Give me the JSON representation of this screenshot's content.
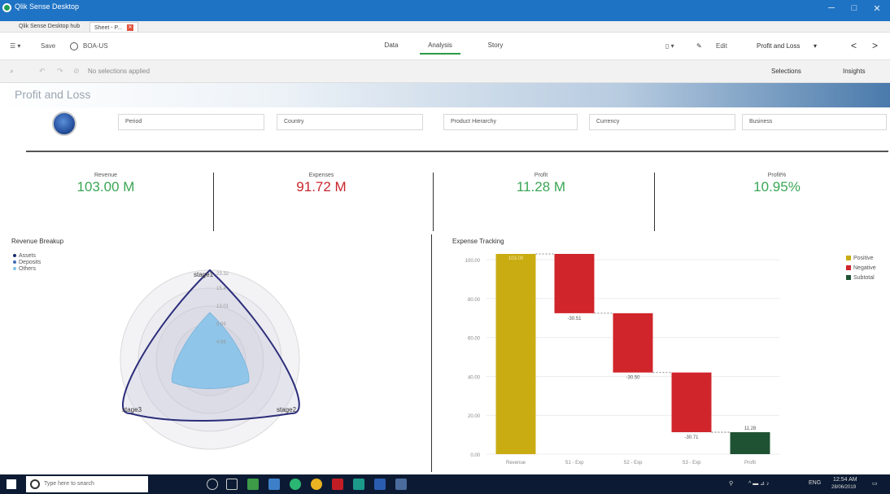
{
  "window": {
    "title": "Qlik Sense Desktop",
    "minimize": "─",
    "maximize": "□",
    "close": "✕"
  },
  "tabs": [
    {
      "label": "Qlik Sense Desktop hub"
    },
    {
      "label": "Sheet - P... "
    }
  ],
  "toolbar": {
    "menu_icon": "☰ ▾",
    "save": "Save",
    "app_name": "BOA-US",
    "nav_tabs": [
      "Data",
      "Analysis",
      "Story"
    ],
    "active_tab": "Analysis",
    "bookmark": "▯ ▾",
    "edit": "Edit",
    "sheet_name": "Profit and Loss",
    "prev": "<",
    "next": ">"
  },
  "selections": {
    "status": "No selections applied",
    "selections_label": "Selections",
    "insights_label": "Insights"
  },
  "sheet": {
    "title": "Profit and Loss"
  },
  "filters": [
    "Period",
    "Country",
    "Product Hierarchy",
    "Currency",
    "Business"
  ],
  "kpis": [
    {
      "label": "Revenue",
      "value": "103.00 M",
      "color": "#3aa655"
    },
    {
      "label": "Expenses",
      "value": "91.72 M",
      "color": "#c8262b"
    },
    {
      "label": "Profit",
      "value": "11.28 M",
      "color": "#3aa655"
    },
    {
      "label": "Profit%",
      "value": "10.95%",
      "color": "#3aa655"
    }
  ],
  "radar": {
    "title": "Revenue Breakup",
    "legend": [
      {
        "label": "Assets",
        "color": "#1b2a6b"
      },
      {
        "label": "Deposits",
        "color": "#3f6db5"
      },
      {
        "label": "Others",
        "color": "#7fc4e8"
      }
    ],
    "axes": [
      "stage1",
      "stage2",
      "stage3"
    ],
    "ring_labels": [
      "4.99",
      "9.99",
      "13.01",
      "15.4",
      "23.32"
    ]
  },
  "chart_data": {
    "type": "bar",
    "subtype": "waterfall",
    "title": "Expense Tracking",
    "categories": [
      "Revenue",
      "S1 - Exp",
      "S2 - Exp",
      "S3 - Exp",
      "Profit"
    ],
    "bars": [
      {
        "category": "Revenue",
        "start": 0,
        "end": 103.0,
        "label": "103.00",
        "kind": "Positive"
      },
      {
        "category": "S1 - Exp",
        "start": 103.0,
        "end": 72.49,
        "label": "-30.51",
        "kind": "Negative"
      },
      {
        "category": "S2 - Exp",
        "start": 72.49,
        "end": 41.99,
        "label": "-30.50",
        "kind": "Negative"
      },
      {
        "category": "S3 - Exp",
        "start": 41.99,
        "end": 11.28,
        "label": "-30.71",
        "kind": "Negative"
      },
      {
        "category": "Profit",
        "start": 0,
        "end": 11.28,
        "label": "11.28",
        "kind": "Subtotal"
      }
    ],
    "yticks": [
      "0.00",
      "20.00",
      "40.00",
      "60.00",
      "80.00",
      "100.00"
    ],
    "ylim": [
      0,
      103
    ],
    "legend": [
      {
        "label": "Positive",
        "color": "#c9ac12"
      },
      {
        "label": "Negative",
        "color": "#d0252a"
      },
      {
        "label": "Subtotal",
        "color": "#1f5232"
      }
    ]
  },
  "taskbar": {
    "search_placeholder": "Type here to search",
    "language": "ENG",
    "time": "12:54 AM",
    "date": "28/06/2019"
  }
}
